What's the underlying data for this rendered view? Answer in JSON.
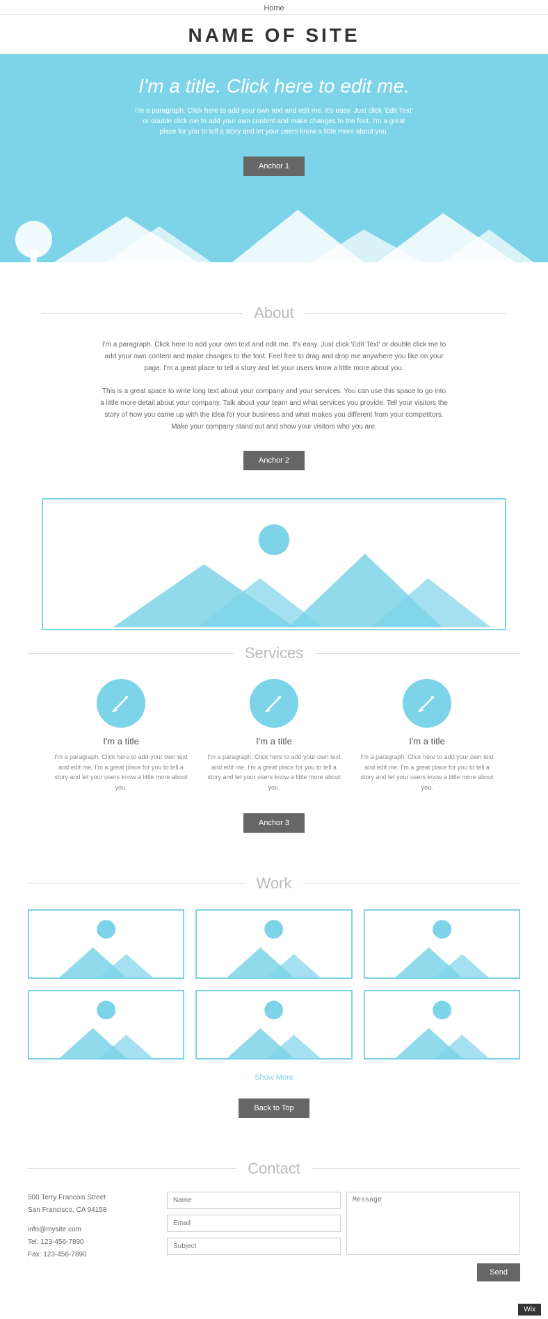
{
  "nav": {
    "home_label": "Home"
  },
  "header": {
    "site_title": "NAME OF SITE"
  },
  "hero": {
    "title": "I'm a title. Click here to edit me.",
    "paragraph": "I'm a paragraph. Click here to add your own text and edit me. It's easy. Just click 'Edit Text' or double click me to add your own content and make changes to the font. I'm a great place for you to tell a story and let your users know a little more about you.",
    "anchor_label": "Anchor 1"
  },
  "about": {
    "section_title": "About",
    "paragraph1": "I'm a paragraph. Click here to add your own text and edit me. It's easy. Just click 'Edit Text' or double click me to add your own content and make changes to the font. Feel free to drag and drop me anywhere you like on your page. I'm a great place to tell a story and let your users know a little more about you.",
    "paragraph2": "This is a great space to write long text about your company and your services. You can use this space to go into a little more detail about your company. Talk about your team and what services you provide. Tell your visitors the story of how you came up with the idea for your business and what makes you different from your competitors. Make your company stand out and show your visitors who you are.",
    "anchor_label": "Anchor 2"
  },
  "services": {
    "section_title": "Services",
    "items": [
      {
        "title": "I'm a title",
        "text": "I'm a paragraph. Click here to add your own text and edit me. I'm a great place for you to tell a story and let your users know a little more about you."
      },
      {
        "title": "I'm a title",
        "text": "I'm a paragraph. Click here to add your own text and edit me. I'm a great place for you to tell a story and let your users know a little more about you."
      },
      {
        "title": "I'm a title",
        "text": "I'm a paragraph. Click here to add your own text and edit me. I'm a great place for you to tell a story and let your users know a little more about you."
      }
    ],
    "anchor_label": "Anchor 3"
  },
  "work": {
    "section_title": "Work",
    "show_more_label": "Show More",
    "back_to_top_label": "Back to Top"
  },
  "contact": {
    "section_title": "Contact",
    "address_line1": "500 Terry Francois Street",
    "address_line2": "San Francisco, CA 94158",
    "email": "info@mysite.com",
    "tel": "Tel: 123-456-7890",
    "fax": "Fax: 123-456-7890",
    "name_placeholder": "Name",
    "email_placeholder": "Email",
    "subject_placeholder": "Subject",
    "message_placeholder": "Message",
    "send_label": "Send"
  },
  "footer": {
    "wix_label": "Wix"
  }
}
